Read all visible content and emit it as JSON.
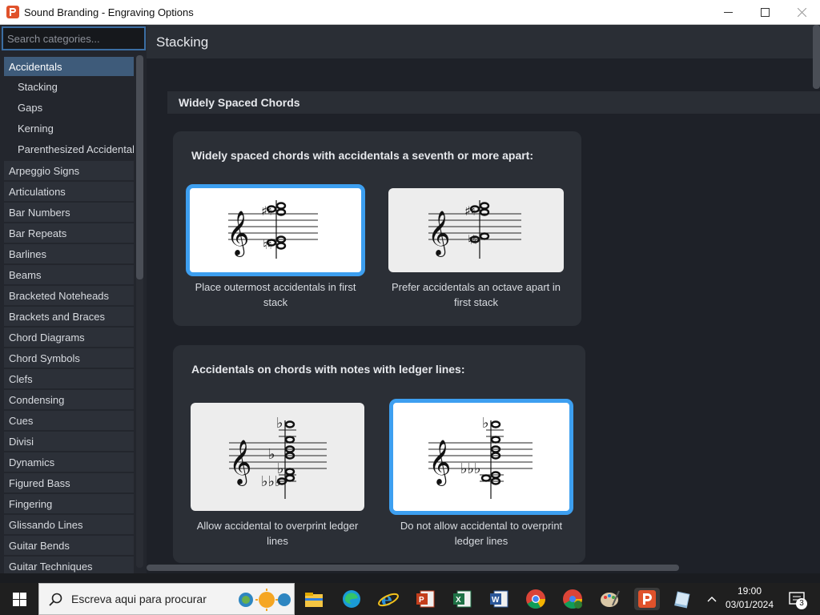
{
  "window": {
    "title": "Sound Branding - Engraving Options"
  },
  "sidebar": {
    "search_placeholder": "Search categories...",
    "selected": "Accidentals",
    "subitems": [
      "Stacking",
      "Gaps",
      "Kerning",
      "Parenthesized Accidental."
    ],
    "items": [
      "Arpeggio Signs",
      "Articulations",
      "Bar Numbers",
      "Bar Repeats",
      "Barlines",
      "Beams",
      "Bracketed Noteheads",
      "Brackets and Braces",
      "Chord Diagrams",
      "Chord Symbols",
      "Clefs",
      "Condensing",
      "Cues",
      "Divisi",
      "Dynamics",
      "Figured Bass",
      "Fingering",
      "Glissando Lines",
      "Guitar Bends",
      "Guitar Techniques"
    ]
  },
  "main": {
    "page_title": "Stacking",
    "section_title": "Widely Spaced Chords",
    "panel1": {
      "question": "Widely spaced chords with accidentals a seventh or more apart:",
      "option1": {
        "label": "Place outermost accidentals in first stack",
        "selected": true
      },
      "option2": {
        "label": "Prefer accidentals an octave apart in first stack",
        "selected": false
      }
    },
    "panel2": {
      "question": "Accidentals on chords with notes with ledger lines:",
      "option1": {
        "label": "Allow accidental to overprint ledger lines",
        "selected": false
      },
      "option2": {
        "label": "Do not allow accidental to overprint ledger lines",
        "selected": true
      }
    }
  },
  "taskbar": {
    "search_placeholder": "Escreva aqui para procurar",
    "time": "19:00",
    "date": "03/01/2024",
    "notification_count": "3"
  },
  "colors": {
    "accent": "#3d9ff0",
    "selected_bg": "#3e5b7a",
    "app_brand": "#e0522b"
  }
}
